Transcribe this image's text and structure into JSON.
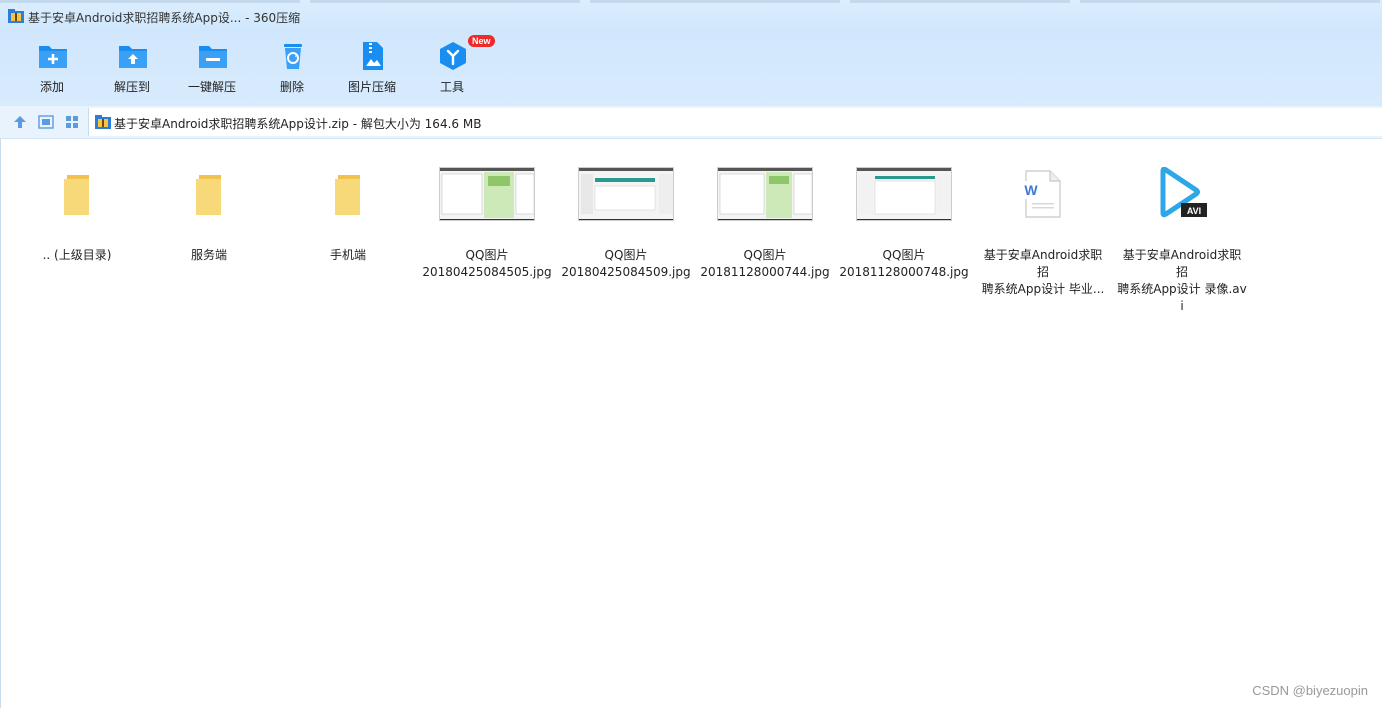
{
  "window": {
    "title": "基于安卓Android求职招聘系统App设... - 360压缩"
  },
  "toolbar": {
    "buttons": [
      {
        "label": "添加",
        "icon": "add-folder-icon"
      },
      {
        "label": "解压到",
        "icon": "extract-to-icon"
      },
      {
        "label": "一键解压",
        "icon": "one-click-extract-icon"
      },
      {
        "label": "删除",
        "icon": "recycle-bin-icon"
      },
      {
        "label": "图片压缩",
        "icon": "image-compress-icon"
      },
      {
        "label": "工具",
        "icon": "tools-icon",
        "badge": "New"
      }
    ]
  },
  "address": {
    "path": "基于安卓Android求职招聘系统App设计.zip - 解包大小为 164.6 MB"
  },
  "files": [
    {
      "type": "folder",
      "name_line1": ".. (上级目录)",
      "name_line2": ""
    },
    {
      "type": "folder",
      "name_line1": "服务端",
      "name_line2": ""
    },
    {
      "type": "folder",
      "name_line1": "手机端",
      "name_line2": ""
    },
    {
      "type": "image",
      "name_line1": "QQ图片",
      "name_line2": "20180425084505.jpg"
    },
    {
      "type": "image",
      "name_line1": "QQ图片",
      "name_line2": "20180425084509.jpg"
    },
    {
      "type": "image",
      "name_line1": "QQ图片",
      "name_line2": "20181128000744.jpg"
    },
    {
      "type": "image",
      "name_line1": "QQ图片",
      "name_line2": "20181128000748.jpg"
    },
    {
      "type": "doc",
      "name_line1": "基于安卓Android求职招",
      "name_line2": "聘系统App设计 毕业..."
    },
    {
      "type": "video",
      "name_line1": "基于安卓Android求职招",
      "name_line2": "聘系统App设计 录像.avi",
      "badge": "AVI"
    }
  ],
  "watermark": "CSDN @biyezuopin",
  "colors": {
    "toolbar_bg": "#d1e7fd",
    "icon_blue": "#1a8ef0",
    "folder_yellow": "#f7d36b",
    "new_badge": "#ee2a2a"
  }
}
